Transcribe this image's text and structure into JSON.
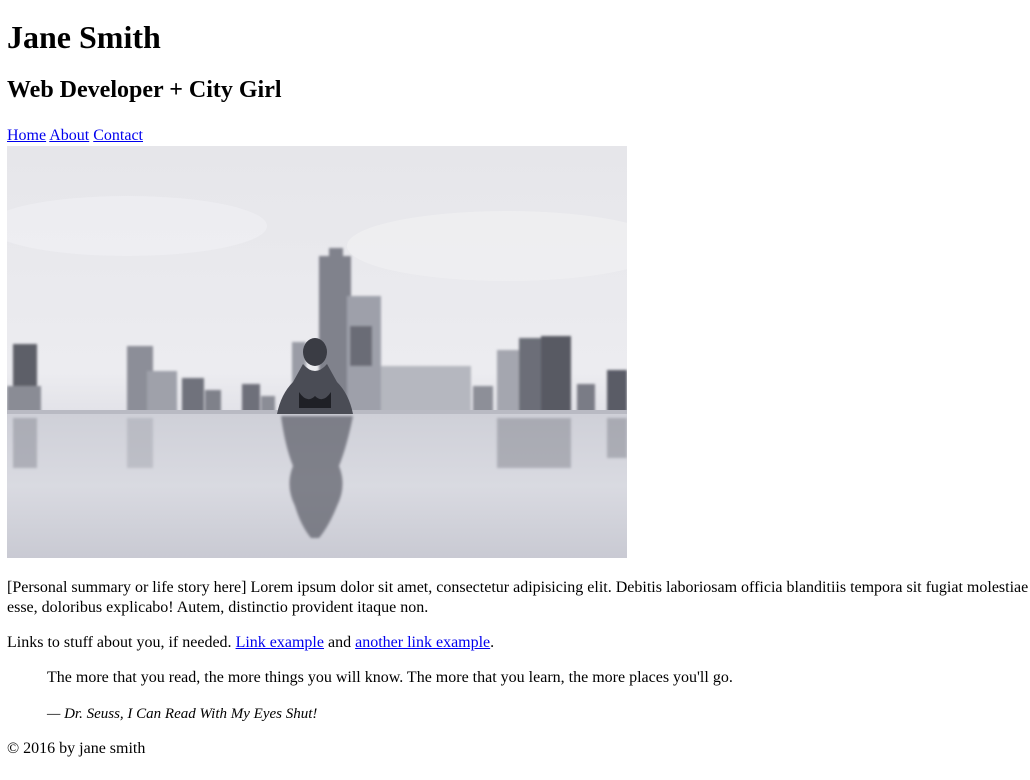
{
  "header": {
    "name": "Jane Smith",
    "tagline": "Web Developer + City Girl"
  },
  "nav": {
    "items": [
      {
        "label": "Home"
      },
      {
        "label": "About"
      },
      {
        "label": "Contact"
      }
    ]
  },
  "hero": {
    "description_icon": "photo-woman-infinity-pool-city-skyline"
  },
  "main": {
    "summary": "[Personal summary or life story here] Lorem ipsum dolor sit amet, consectetur adipisicing elit. Debitis laboriosam officia blanditiis tempora sit fugiat molestiae esse, doloribus explicabo! Autem, distinctio provident itaque non.",
    "links_intro": "Links to stuff about you, if needed.",
    "link1": "Link example",
    "links_and": "and",
    "link2": "another link example",
    "links_end": ".",
    "quote": "The more that you read, the more things you will know. The more that you learn, the more places you'll go.",
    "quote_attribution": "— Dr. Seuss, I Can Read With My Eyes Shut!"
  },
  "footer": {
    "copyright": "© 2016 by jane smith"
  },
  "colors": {
    "link": "#0000ee",
    "text": "#000000",
    "background": "#ffffff"
  }
}
